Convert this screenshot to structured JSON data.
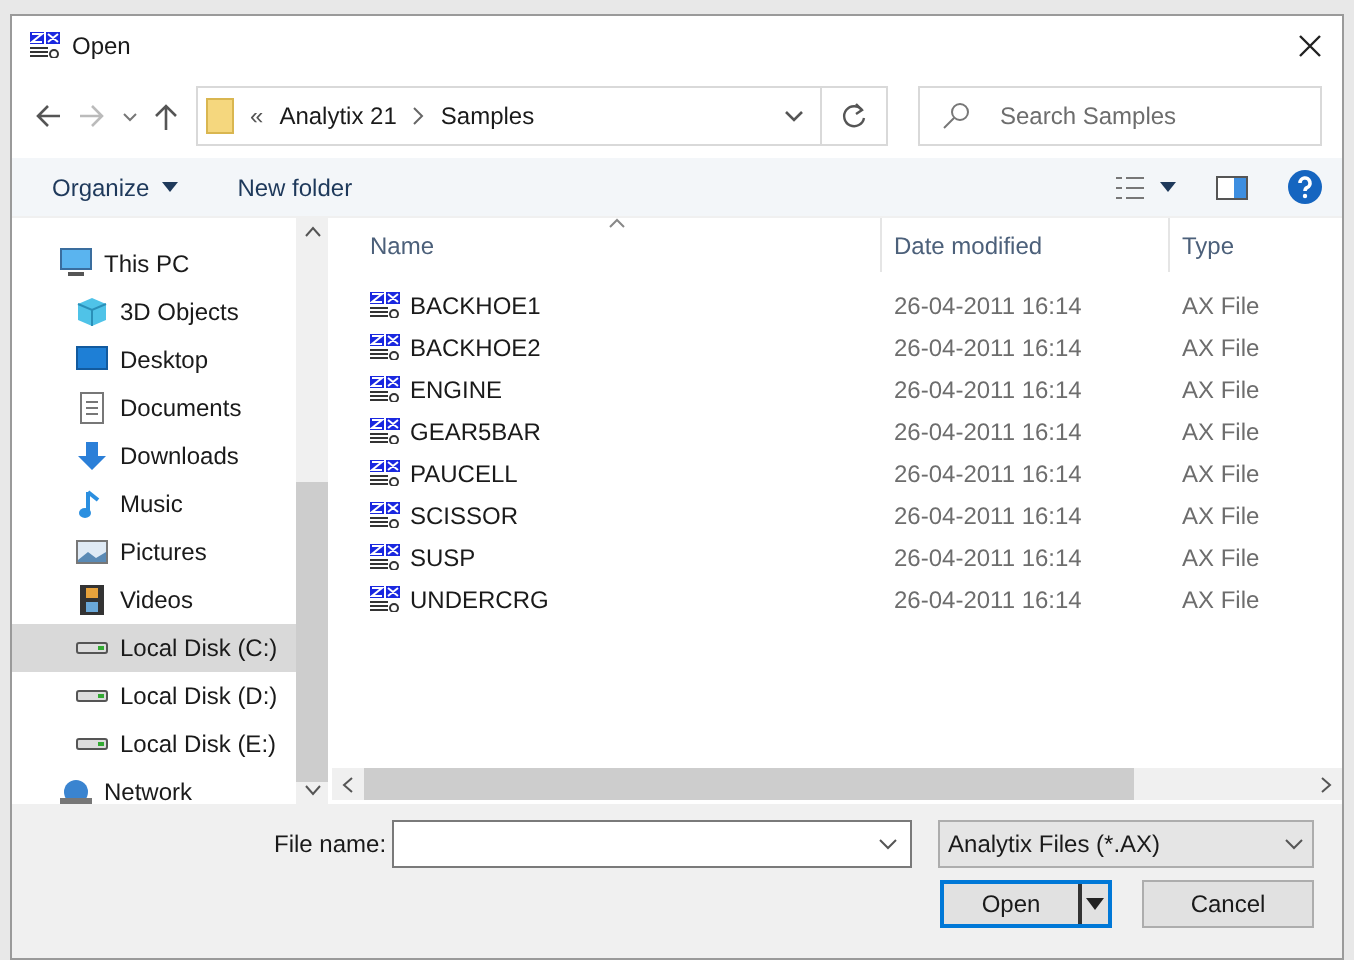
{
  "window": {
    "title": "Open"
  },
  "nav": {
    "breadcrumb_prefix": "«",
    "path": [
      "Analytix 21",
      "Samples"
    ],
    "search": {
      "placeholder": "Search Samples"
    }
  },
  "toolbar": {
    "organize": "Organize",
    "new_folder": "New folder"
  },
  "sidebar": {
    "items": [
      {
        "label": "This PC",
        "kind": "pc",
        "selected": false,
        "children": [
          {
            "label": "3D Objects",
            "kind": "cube",
            "selected": false
          },
          {
            "label": "Desktop",
            "kind": "desktop",
            "selected": false
          },
          {
            "label": "Documents",
            "kind": "document",
            "selected": false
          },
          {
            "label": "Downloads",
            "kind": "download",
            "selected": false
          },
          {
            "label": "Music",
            "kind": "music",
            "selected": false
          },
          {
            "label": "Pictures",
            "kind": "picture",
            "selected": false
          },
          {
            "label": "Videos",
            "kind": "video",
            "selected": false
          },
          {
            "label": "Local Disk (C:)",
            "kind": "drive",
            "selected": true
          },
          {
            "label": "Local Disk (D:)",
            "kind": "drive",
            "selected": false
          },
          {
            "label": "Local Disk (E:)",
            "kind": "drive",
            "selected": false
          }
        ]
      },
      {
        "label": "Network",
        "kind": "network",
        "selected": false
      }
    ]
  },
  "table": {
    "columns": [
      "Name",
      "Date modified",
      "Type"
    ],
    "rows": [
      {
        "name": "BACKHOE1",
        "date": "26-04-2011 16:14",
        "type": "AX File"
      },
      {
        "name": "BACKHOE2",
        "date": "26-04-2011 16:14",
        "type": "AX File"
      },
      {
        "name": "ENGINE",
        "date": "26-04-2011 16:14",
        "type": "AX File"
      },
      {
        "name": "GEAR5BAR",
        "date": "26-04-2011 16:14",
        "type": "AX File"
      },
      {
        "name": "PAUCELL",
        "date": "26-04-2011 16:14",
        "type": "AX File"
      },
      {
        "name": "SCISSOR",
        "date": "26-04-2011 16:14",
        "type": "AX File"
      },
      {
        "name": "SUSP",
        "date": "26-04-2011 16:14",
        "type": "AX File"
      },
      {
        "name": "UNDERCRG",
        "date": "26-04-2011 16:14",
        "type": "AX File"
      }
    ]
  },
  "file_name": {
    "label": "File name:"
  },
  "file_type": "Analytix Files (*.AX)",
  "buttons": [
    {
      "label": "Open",
      "kind": "split"
    },
    {
      "label": "Cancel",
      "kind": "plain"
    }
  ]
}
